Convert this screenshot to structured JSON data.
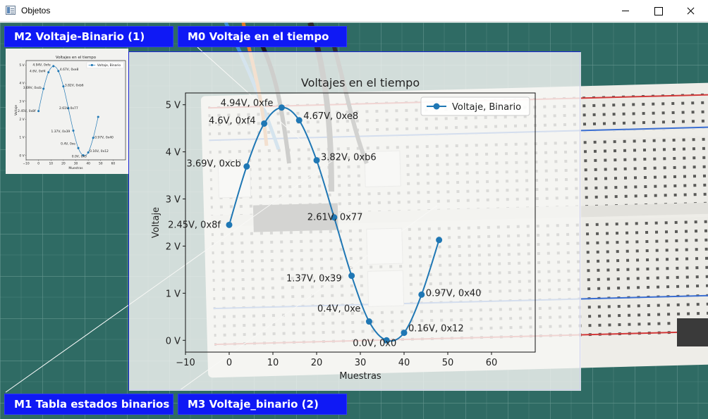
{
  "window": {
    "title": "Objetos"
  },
  "labels": {
    "m2": "M2 Voltaje-Binario (1)",
    "m0": "M0 Voltaje en el tiempo",
    "m1": "M1 Tabla estados binarios",
    "m3": "M3 Voltaje_binario (2)"
  },
  "colors": {
    "label_bg": "#0f19f5",
    "series": "#1f77b4",
    "scene": "#2f6b64"
  },
  "chart_data": {
    "type": "line",
    "title": "Voltajes en el tiempo",
    "xlabel": "Muestras",
    "ylabel": "Voltaje",
    "xlim": [
      -10,
      70
    ],
    "ylim": [
      -0.25,
      5.25
    ],
    "x_ticks": [
      "−10",
      "0",
      "10",
      "20",
      "30",
      "40",
      "50",
      "60"
    ],
    "y_ticks": [
      "0 V",
      "1 V",
      "2 V",
      "3 V",
      "4 V",
      "5 V"
    ],
    "grid": false,
    "legend": "top-right",
    "series": [
      {
        "name": "Voltaje, Binario",
        "x": [
          0,
          4,
          8,
          12,
          16,
          20,
          24,
          28,
          32,
          36,
          40,
          44,
          48
        ],
        "y": [
          2.45,
          3.69,
          4.6,
          4.94,
          4.67,
          3.82,
          2.61,
          1.37,
          0.4,
          0.0,
          0.16,
          0.97,
          2.13
        ]
      }
    ],
    "annotations": [
      "2.45V, 0x8f",
      "3.69V, 0xcb",
      "4.6V, 0xf4",
      "4.94V, 0xfe",
      "4.67V, 0xe8",
      "3.82V, 0xb6",
      "2.61V, 0x77",
      "1.37V, 0x39",
      "0.4V, 0xe",
      "0.0V, 0x0",
      "0.16V, 0x12",
      "0.97V, 0x40"
    ]
  }
}
